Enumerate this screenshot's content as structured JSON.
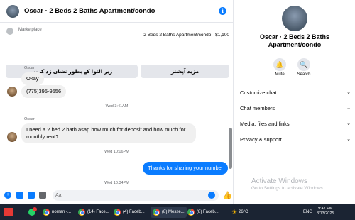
{
  "header": {
    "title": "Oscar · 2 Beds 2 Baths Apartment/condo",
    "info_icon": "info-icon"
  },
  "marketplace": {
    "label": "Marketplace",
    "item": "2 Beds 2 Baths Apartment/condo - $1,100",
    "buttons": [
      "زیر التوا کے بطور نشان زد کریں",
      "مزید آپشنز"
    ]
  },
  "messages": [
    {
      "sender": "Oscar",
      "text": "Okay"
    },
    {
      "text": "(775)395-9556"
    },
    {
      "timestamp": "Wed 3:41AM"
    },
    {
      "sender": "Oscar",
      "text": "I need a 2 bed 2 bath asap how much for deposit and how much for monthly rent?"
    },
    {
      "timestamp": "Wed 10:06PM"
    },
    {
      "text": "Thanks for sharing your number",
      "outgoing": true
    },
    {
      "timestamp": "Wed 10:34PM"
    }
  ],
  "composer": {
    "placeholder": "Aa"
  },
  "right": {
    "name": "Oscar · 2 Beds 2 Baths Apartment/condo",
    "actions": [
      {
        "label": "Mute",
        "icon": "bell-icon"
      },
      {
        "label": "Search",
        "icon": "search-icon"
      }
    ],
    "sections": [
      "Customize chat",
      "Chat members",
      "Media, files and links",
      "Privacy & support"
    ]
  },
  "watermark": {
    "line1": "Activate Windows",
    "line2": "Go to Settings to activate Windows."
  },
  "taskbar": {
    "items": [
      "noman -...",
      "(14) Face...",
      "(4) Faceb...",
      "(8) Messe...",
      "(8) Faceb..."
    ],
    "weather": "26°C",
    "lang": "ENG",
    "time": "9:47 PM",
    "date": "3/13/2025"
  },
  "colors": {
    "accent": "#0a7cff",
    "bubble_in": "#f0f0f0",
    "taskbar": "#1b2433"
  }
}
